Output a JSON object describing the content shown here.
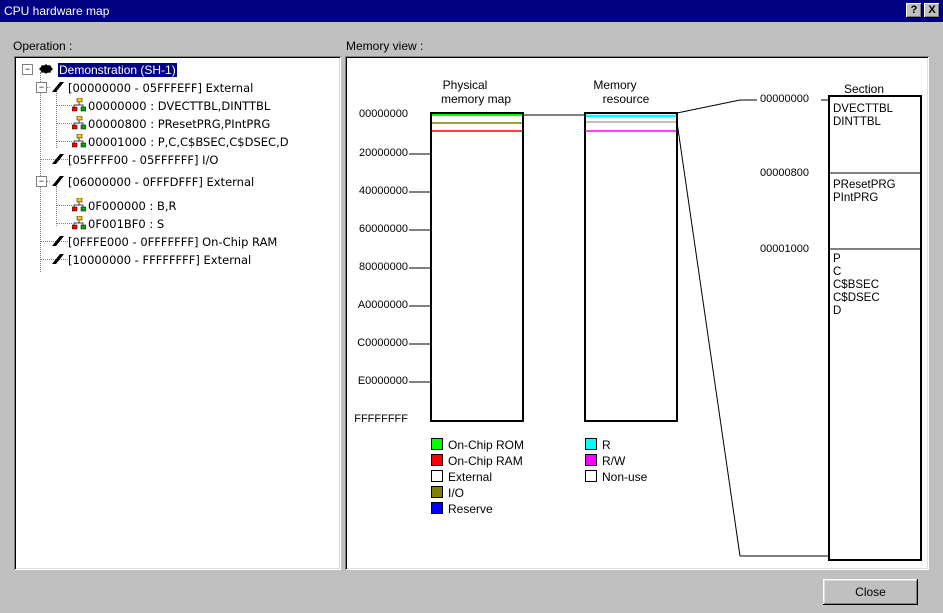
{
  "window": {
    "title": "CPU hardware map",
    "help_label": "?",
    "close_label": "X"
  },
  "panels": {
    "operation_label": "Operation :",
    "memory_view_label": "Memory view :"
  },
  "tree": {
    "root": "Demonstration (SH-1)",
    "items": [
      {
        "label": "[00000000 - 05FFFEFF] External"
      },
      {
        "label": "00000000 : DVECTTBL,DINTTBL"
      },
      {
        "label": "00000800 : PResetPRG,PIntPRG"
      },
      {
        "label": "00001000 : P,C,C$BSEC,C$DSEC,D"
      },
      {
        "label": "[05FFFF00 - 05FFFFFF] I/O"
      },
      {
        "label": "[06000000 - 0FFFDFFF] External"
      },
      {
        "label": "0F000000 : B,R"
      },
      {
        "label": "0F001BF0 : S"
      },
      {
        "label": "[0FFFE000 - 0FFFFFFF] On-Chip RAM"
      },
      {
        "label": "[10000000 - FFFFFFFF] External"
      }
    ]
  },
  "memory_view": {
    "physical_title_1": "Physical",
    "physical_title_2": "memory map",
    "resource_title_1": "Memory",
    "resource_title_2": "resource",
    "section_title": "Section",
    "axis_labels": [
      "00000000",
      "20000000",
      "40000000",
      "60000000",
      "80000000",
      "A0000000",
      "C0000000",
      "E0000000",
      "FFFFFFFF"
    ],
    "section_addresses": [
      "00000000",
      "00000800",
      "00001000"
    ],
    "sections": [
      {
        "lines": [
          "DVECTTBL",
          "DINTTBL"
        ]
      },
      {
        "lines": [
          "PResetPRG",
          "PIntPRG"
        ]
      },
      {
        "lines": [
          "P",
          "C",
          "C$BSEC",
          "C$DSEC",
          "D"
        ]
      }
    ],
    "legend_physical": [
      {
        "label": "On-Chip ROM",
        "color": "#00ff00"
      },
      {
        "label": "On-Chip RAM",
        "color": "#ff0000"
      },
      {
        "label": "External",
        "color": "#ffffff"
      },
      {
        "label": "I/O",
        "color": "#808000"
      },
      {
        "label": "Reserve",
        "color": "#0000ff"
      }
    ],
    "legend_resource": [
      {
        "label": "R",
        "color": "#00ffff"
      },
      {
        "label": "R/W",
        "color": "#ff00ff"
      },
      {
        "label": "Non-use",
        "color": "#ffffff"
      }
    ]
  },
  "buttons": {
    "close": "Close"
  }
}
